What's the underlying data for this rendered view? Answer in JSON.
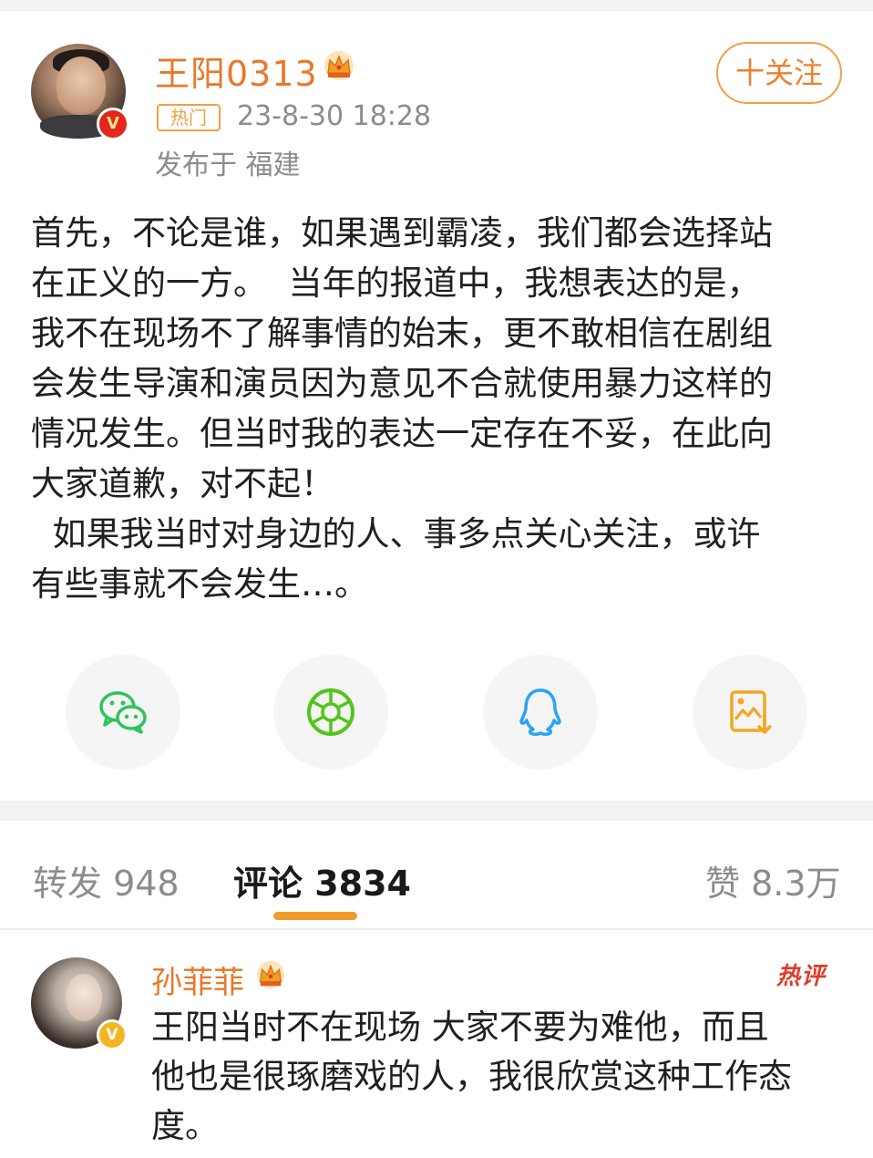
{
  "post": {
    "username": "王阳0313",
    "hot_tag": "热门",
    "time": "23-8-30 18:28",
    "location": "发布于 福建",
    "follow_label": "十关注",
    "verify_mark": "V",
    "body": "首先，不论是谁，如果遇到霸凌，我们都会选择站\n在正义的一方。  当年的报道中，我想表达的是，\n我不在现场不了解事情的始末，更不敢相信在剧组\n会发生导演和演员因为意见不合就使用暴力这样的\n情况发生。但当时我的表达一定存在不妥，在此向\n大家道歉，对不起！\n  如果我当时对身边的人、事多点关心关注，或许\n有些事就不会发生…。"
  },
  "share": [
    {
      "icon": "wechat-icon",
      "color": "#2fc35a"
    },
    {
      "icon": "moments-icon",
      "color": "#52c41a"
    },
    {
      "icon": "qq-icon",
      "color": "#2aa4f5"
    },
    {
      "icon": "save-image-icon",
      "color": "#f5a623"
    }
  ],
  "tabs": {
    "repost": "转发 948",
    "comments": "评论 3834",
    "likes": "赞 8.3万"
  },
  "comment": {
    "username": "孙菲菲",
    "badge": "热评",
    "verify_mark": "V",
    "text": "王阳当时不在现场 大家不要为难他，而且\n他也是很琢磨戏的人，我很欣赏这种工作态\n度。"
  }
}
